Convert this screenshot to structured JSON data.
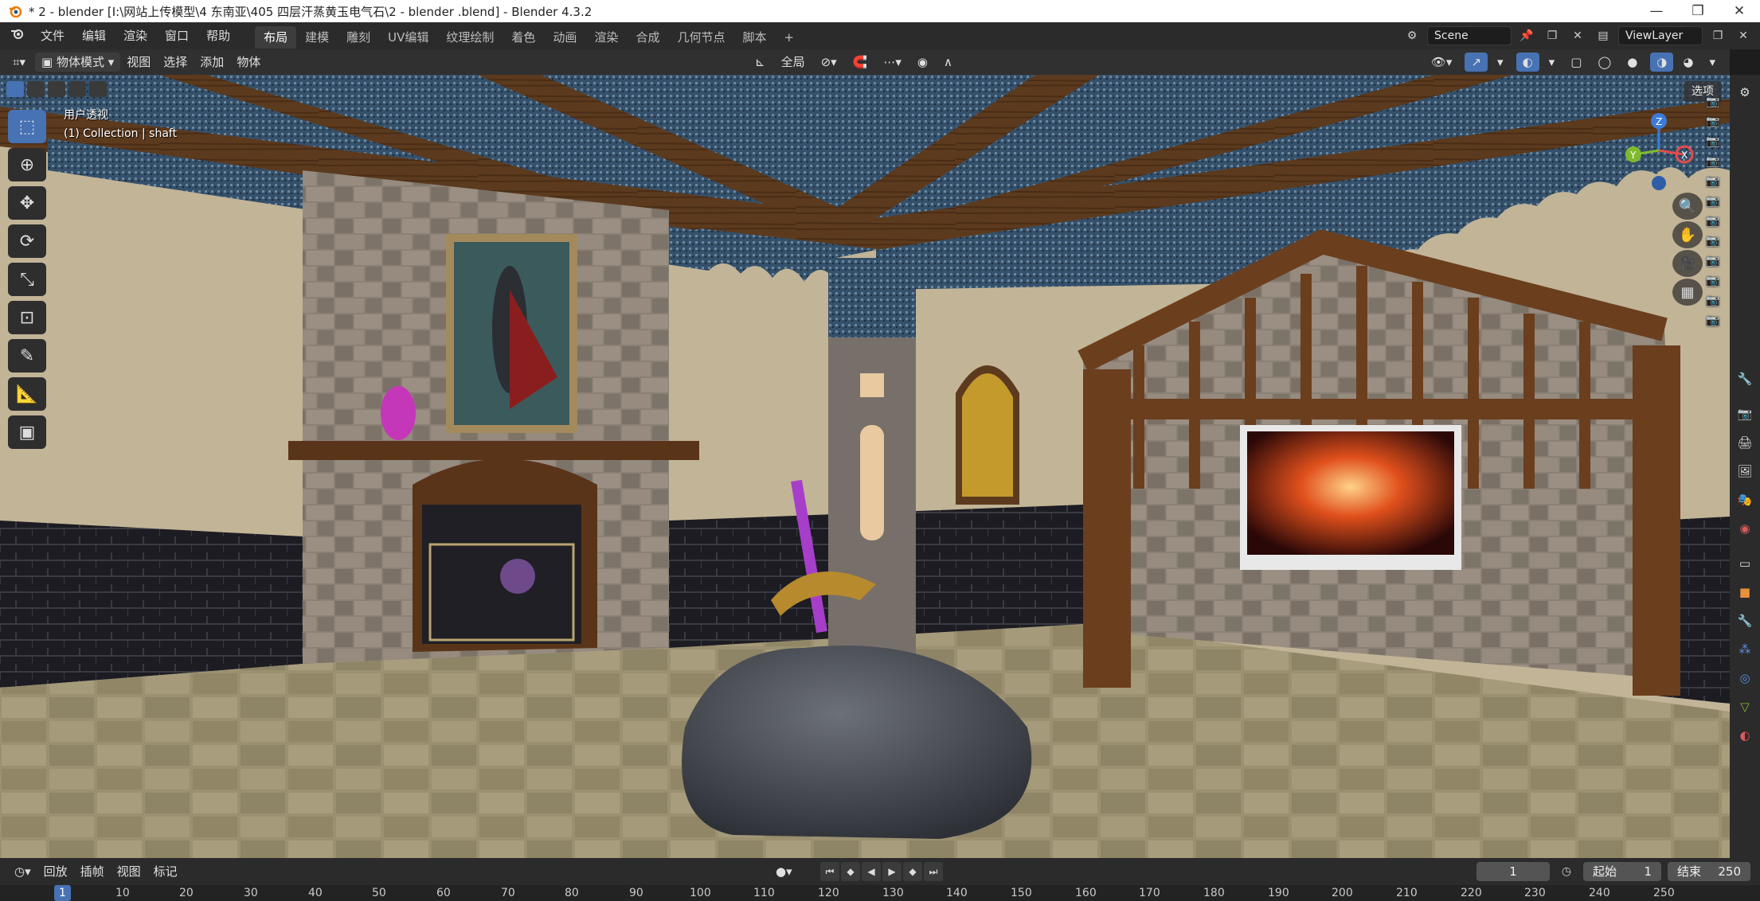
{
  "window": {
    "title": "* 2 - blender  [I:\\网站上传模型\\4 东南亚\\405 四层汗蒸黄玉电气石\\2 - blender .blend] - Blender 4.3.2",
    "minimize": "—",
    "maximize": "❐",
    "close": "✕"
  },
  "menu": {
    "items": [
      "文件",
      "编辑",
      "渲染",
      "窗口",
      "帮助"
    ],
    "tabs": [
      "布局",
      "建模",
      "雕刻",
      "UV编辑",
      "纹理绘制",
      "着色",
      "动画",
      "渲染",
      "合成",
      "几何节点",
      "脚本"
    ],
    "active_tab": "布局",
    "add_tab": "+",
    "scene": "Scene",
    "view_layer": "ViewLayer"
  },
  "viewport_header": {
    "mode": "物体模式",
    "items": [
      "视图",
      "选择",
      "添加",
      "物体"
    ],
    "transform_orientation": "全局",
    "options_label": "选项"
  },
  "viewport": {
    "view_name": "用户透视",
    "collection_info": "(1) Collection | shaft",
    "gizmo": {
      "x": "X",
      "y": "Y",
      "z": "Z"
    }
  },
  "timeline": {
    "items": [
      "回放",
      "插帧",
      "视图",
      "标记"
    ],
    "current_frame": "1",
    "start_label": "起始",
    "start_value": "1",
    "end_label": "结束",
    "end_value": "250",
    "ruler": [
      "1",
      "10",
      "20",
      "30",
      "40",
      "50",
      "60",
      "70",
      "80",
      "90",
      "100",
      "110",
      "120",
      "130",
      "140",
      "150",
      "160",
      "170",
      "180",
      "190",
      "200",
      "210",
      "220",
      "230",
      "240",
      "250"
    ]
  },
  "colors": {
    "accent": "#4772b3",
    "header": "#303030",
    "background": "#1d1d1d"
  }
}
